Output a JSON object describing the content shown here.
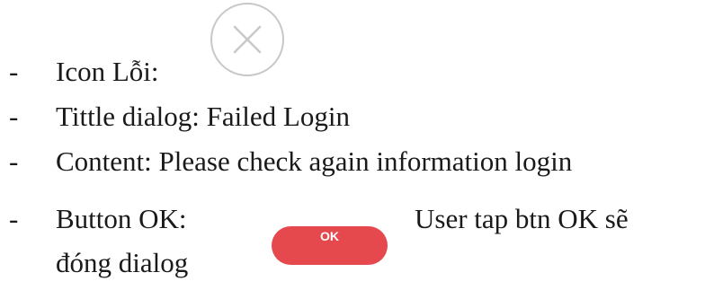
{
  "bullets": {
    "icon_label": "Icon Lỗi:",
    "title_line": "Tittle dialog: Failed Login",
    "content_line": "Content: Please check again information login",
    "button_label_prefix": "Button OK:",
    "button_desc_1": "User tap btn OK sẽ",
    "button_desc_2": "đóng dialog",
    "dash": "-"
  },
  "ok_button": {
    "label": "OK",
    "color": "#e5484d"
  },
  "error_icon": {
    "name": "close-circle-icon",
    "color": "#c8c8c8"
  }
}
